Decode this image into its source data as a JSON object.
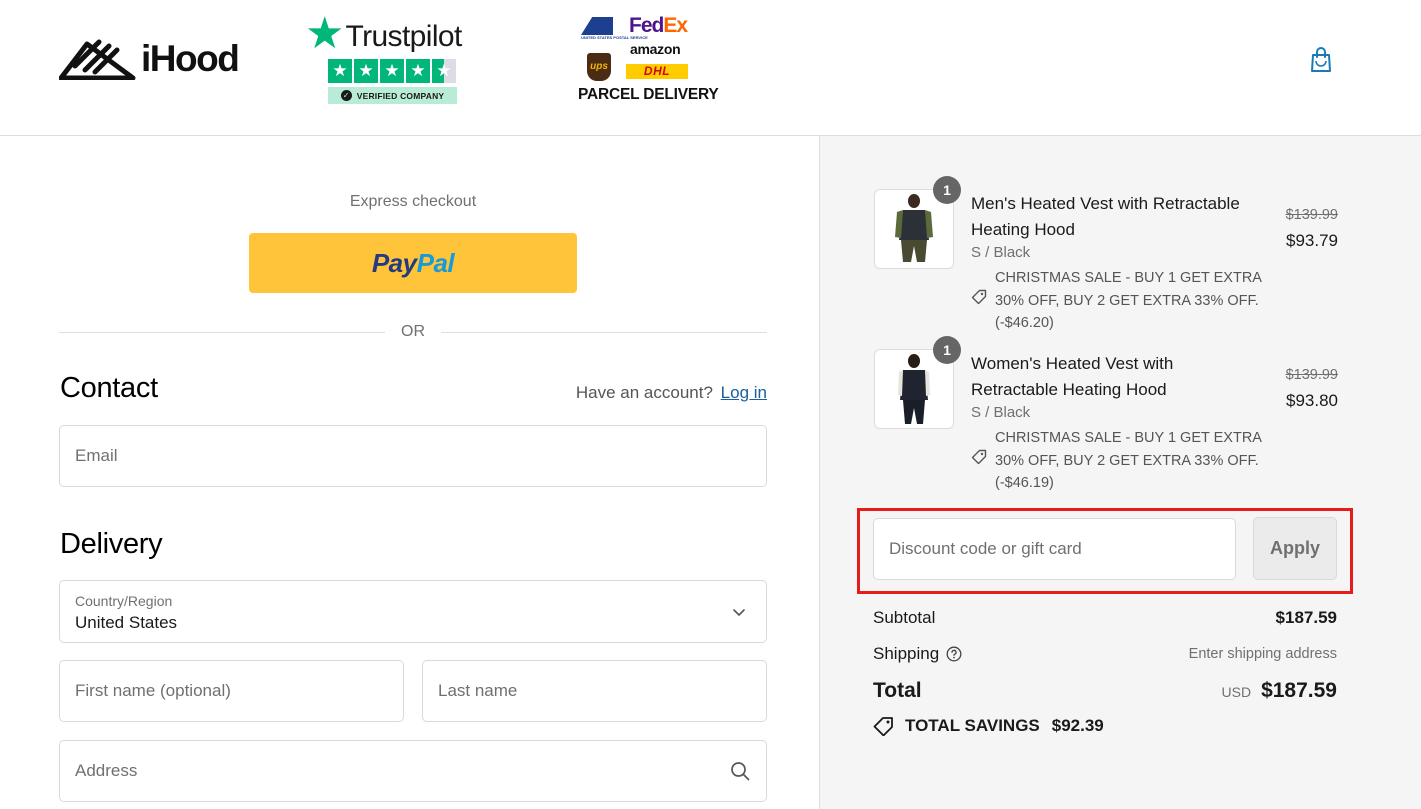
{
  "header": {
    "logo_text": "iHood",
    "trustpilot": {
      "name": "Trustpilot",
      "badge": "VERIFIED COMPANY",
      "rating_stars": 4.5
    },
    "carriers": {
      "fedex_fe": "Fed",
      "fedex_ex": "Ex",
      "amazon": "amazon",
      "ups": "ups",
      "dhl": "DHL",
      "usps": "UNITED STATES POSTAL SERVICE",
      "parcel": "PARCEL DELIVERY"
    },
    "cart_icon": "shopping-bag-icon"
  },
  "express": {
    "label": "Express checkout",
    "paypal_pay": "Pay",
    "paypal_pal": "Pal",
    "or": "OR"
  },
  "contact": {
    "title": "Contact",
    "have_account": "Have an account?",
    "login": "Log in",
    "email_placeholder": "Email"
  },
  "delivery": {
    "title": "Delivery",
    "country_label": "Country/Region",
    "country_value": "United States",
    "first_name_placeholder": "First name (optional)",
    "last_name_placeholder": "Last name",
    "address_placeholder": "Address"
  },
  "cart": {
    "items": [
      {
        "qty": "1",
        "name": "Men's Heated Vest with Retractable Heating Hood",
        "variant": "S / Black",
        "discount": "CHRISTMAS SALE - BUY 1 GET EXTRA 30% OFF, BUY 2 GET EXTRA 33% OFF. (-$46.20)",
        "price_old": "$139.99",
        "price_new": "$93.79"
      },
      {
        "qty": "1",
        "name": "Women's Heated Vest with Retractable Heating Hood",
        "variant": "S / Black",
        "discount": "CHRISTMAS SALE - BUY 1 GET EXTRA 30% OFF, BUY 2 GET EXTRA 33% OFF. (-$46.19)",
        "price_old": "$139.99",
        "price_new": "$93.80"
      }
    ],
    "discount_placeholder": "Discount code or gift card",
    "apply": "Apply",
    "subtotal_label": "Subtotal",
    "subtotal_value": "$187.59",
    "shipping_label": "Shipping",
    "shipping_value": "Enter shipping address",
    "total_label": "Total",
    "currency": "USD",
    "total_value": "$187.59",
    "savings_label": "TOTAL SAVINGS",
    "savings_value": "$92.39"
  },
  "colors": {
    "paypal_yellow": "#ffc43a",
    "trustpilot_green": "#00b67a",
    "link_blue": "#1a5fa0",
    "highlight_red": "#e51c1c",
    "summary_bg": "#f5f5f5"
  }
}
